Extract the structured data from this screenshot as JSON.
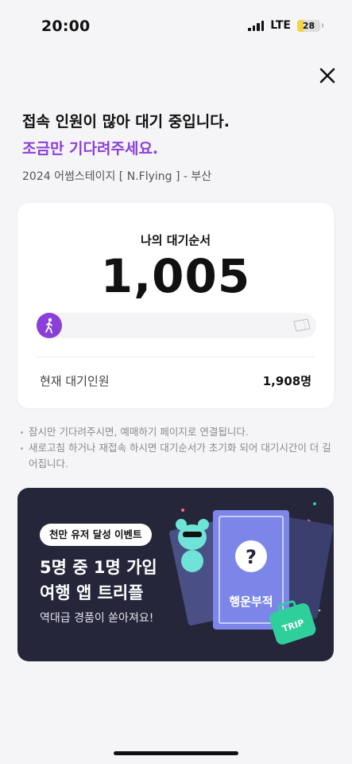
{
  "status_bar": {
    "time": "20:00",
    "network": "LTE",
    "battery": "28",
    "battery_level": 0.28
  },
  "header": {
    "close_icon": "close-icon",
    "heading": "접속 인원이 많아 대기 중입니다.",
    "subheading": "조금만 기다려주세요.",
    "event_name": "2024 어썸스테이지 [ N.Flying ] - 부산"
  },
  "queue": {
    "label": "나의 대기순서",
    "number": "1,005",
    "progress_icon_start": "runner-icon",
    "progress_icon_end": "ticket-icon",
    "waiting_label": "현재 대기인원",
    "waiting_value": "1,908명"
  },
  "notices": [
    "잠시만 기다려주시면, 예매하기 페이지로 연결됩니다.",
    "새로고침 하거나 재접속 하시면 대기순서가 초기화 되어 대기시간이 더 길어집니다."
  ],
  "banner": {
    "pill": "천만 유저 달성 이벤트",
    "title_line1": "5명 중 1명 가입",
    "title_line2": "여행 앱 트리플",
    "subtitle": "역대급 경품이 쏟아져요!",
    "card_text": "행운부적",
    "card_symbol": "?",
    "tag_text": "TRIP",
    "colors": {
      "background": "#25263a",
      "card": "#7b86e8",
      "tag": "#2ecf9a",
      "character": "#6fe3d7"
    }
  },
  "colors": {
    "accent": "#8b3fd9",
    "text": "#111111",
    "muted": "#8a8a8a"
  }
}
